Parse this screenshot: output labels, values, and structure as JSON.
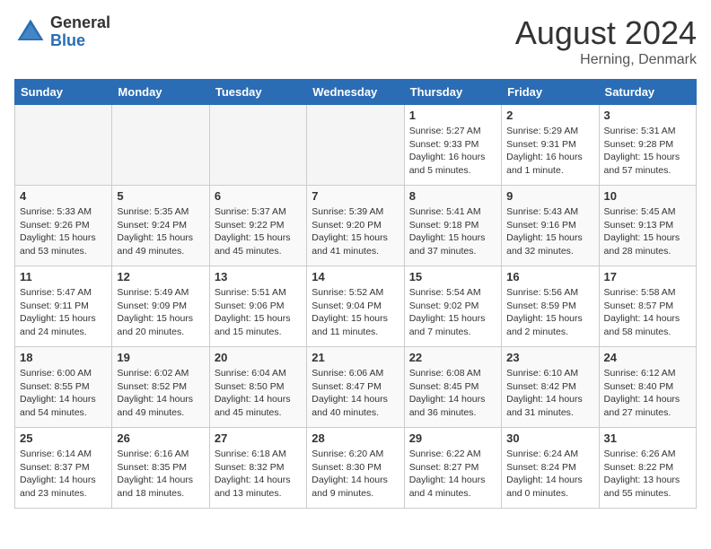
{
  "header": {
    "logo_general": "General",
    "logo_blue": "Blue",
    "title": "August 2024",
    "location": "Herning, Denmark"
  },
  "weekdays": [
    "Sunday",
    "Monday",
    "Tuesday",
    "Wednesday",
    "Thursday",
    "Friday",
    "Saturday"
  ],
  "weeks": [
    [
      {
        "day": "",
        "info": ""
      },
      {
        "day": "",
        "info": ""
      },
      {
        "day": "",
        "info": ""
      },
      {
        "day": "",
        "info": ""
      },
      {
        "day": "1",
        "info": "Sunrise: 5:27 AM\nSunset: 9:33 PM\nDaylight: 16 hours\nand 5 minutes."
      },
      {
        "day": "2",
        "info": "Sunrise: 5:29 AM\nSunset: 9:31 PM\nDaylight: 16 hours\nand 1 minute."
      },
      {
        "day": "3",
        "info": "Sunrise: 5:31 AM\nSunset: 9:28 PM\nDaylight: 15 hours\nand 57 minutes."
      }
    ],
    [
      {
        "day": "4",
        "info": "Sunrise: 5:33 AM\nSunset: 9:26 PM\nDaylight: 15 hours\nand 53 minutes."
      },
      {
        "day": "5",
        "info": "Sunrise: 5:35 AM\nSunset: 9:24 PM\nDaylight: 15 hours\nand 49 minutes."
      },
      {
        "day": "6",
        "info": "Sunrise: 5:37 AM\nSunset: 9:22 PM\nDaylight: 15 hours\nand 45 minutes."
      },
      {
        "day": "7",
        "info": "Sunrise: 5:39 AM\nSunset: 9:20 PM\nDaylight: 15 hours\nand 41 minutes."
      },
      {
        "day": "8",
        "info": "Sunrise: 5:41 AM\nSunset: 9:18 PM\nDaylight: 15 hours\nand 37 minutes."
      },
      {
        "day": "9",
        "info": "Sunrise: 5:43 AM\nSunset: 9:16 PM\nDaylight: 15 hours\nand 32 minutes."
      },
      {
        "day": "10",
        "info": "Sunrise: 5:45 AM\nSunset: 9:13 PM\nDaylight: 15 hours\nand 28 minutes."
      }
    ],
    [
      {
        "day": "11",
        "info": "Sunrise: 5:47 AM\nSunset: 9:11 PM\nDaylight: 15 hours\nand 24 minutes."
      },
      {
        "day": "12",
        "info": "Sunrise: 5:49 AM\nSunset: 9:09 PM\nDaylight: 15 hours\nand 20 minutes."
      },
      {
        "day": "13",
        "info": "Sunrise: 5:51 AM\nSunset: 9:06 PM\nDaylight: 15 hours\nand 15 minutes."
      },
      {
        "day": "14",
        "info": "Sunrise: 5:52 AM\nSunset: 9:04 PM\nDaylight: 15 hours\nand 11 minutes."
      },
      {
        "day": "15",
        "info": "Sunrise: 5:54 AM\nSunset: 9:02 PM\nDaylight: 15 hours\nand 7 minutes."
      },
      {
        "day": "16",
        "info": "Sunrise: 5:56 AM\nSunset: 8:59 PM\nDaylight: 15 hours\nand 2 minutes."
      },
      {
        "day": "17",
        "info": "Sunrise: 5:58 AM\nSunset: 8:57 PM\nDaylight: 14 hours\nand 58 minutes."
      }
    ],
    [
      {
        "day": "18",
        "info": "Sunrise: 6:00 AM\nSunset: 8:55 PM\nDaylight: 14 hours\nand 54 minutes."
      },
      {
        "day": "19",
        "info": "Sunrise: 6:02 AM\nSunset: 8:52 PM\nDaylight: 14 hours\nand 49 minutes."
      },
      {
        "day": "20",
        "info": "Sunrise: 6:04 AM\nSunset: 8:50 PM\nDaylight: 14 hours\nand 45 minutes."
      },
      {
        "day": "21",
        "info": "Sunrise: 6:06 AM\nSunset: 8:47 PM\nDaylight: 14 hours\nand 40 minutes."
      },
      {
        "day": "22",
        "info": "Sunrise: 6:08 AM\nSunset: 8:45 PM\nDaylight: 14 hours\nand 36 minutes."
      },
      {
        "day": "23",
        "info": "Sunrise: 6:10 AM\nSunset: 8:42 PM\nDaylight: 14 hours\nand 31 minutes."
      },
      {
        "day": "24",
        "info": "Sunrise: 6:12 AM\nSunset: 8:40 PM\nDaylight: 14 hours\nand 27 minutes."
      }
    ],
    [
      {
        "day": "25",
        "info": "Sunrise: 6:14 AM\nSunset: 8:37 PM\nDaylight: 14 hours\nand 23 minutes."
      },
      {
        "day": "26",
        "info": "Sunrise: 6:16 AM\nSunset: 8:35 PM\nDaylight: 14 hours\nand 18 minutes."
      },
      {
        "day": "27",
        "info": "Sunrise: 6:18 AM\nSunset: 8:32 PM\nDaylight: 14 hours\nand 13 minutes."
      },
      {
        "day": "28",
        "info": "Sunrise: 6:20 AM\nSunset: 8:30 PM\nDaylight: 14 hours\nand 9 minutes."
      },
      {
        "day": "29",
        "info": "Sunrise: 6:22 AM\nSunset: 8:27 PM\nDaylight: 14 hours\nand 4 minutes."
      },
      {
        "day": "30",
        "info": "Sunrise: 6:24 AM\nSunset: 8:24 PM\nDaylight: 14 hours\nand 0 minutes."
      },
      {
        "day": "31",
        "info": "Sunrise: 6:26 AM\nSunset: 8:22 PM\nDaylight: 13 hours\nand 55 minutes."
      }
    ]
  ]
}
